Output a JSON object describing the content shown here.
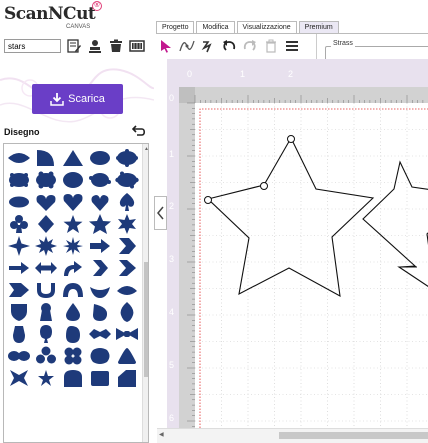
{
  "app": {
    "logo_text": "ScanNCut",
    "logo_subtext": "CANVAS",
    "logo_mark": "®"
  },
  "search": {
    "value": "stars"
  },
  "toolbar_left_icons": [
    "document-edit-icon",
    "user-stamp-icon",
    "trash-box-icon",
    "cutting-mat-icon"
  ],
  "download": {
    "label": "Scarica",
    "icon": "download-icon"
  },
  "panel": {
    "title": "Disegno",
    "back_icon": "undo-arrow-icon"
  },
  "tabs": [
    {
      "label": "Progetto"
    },
    {
      "label": "Modifica"
    },
    {
      "label": "Visualizzazione"
    },
    {
      "label": "Premium"
    }
  ],
  "toolbar": [
    "select-arrow-icon",
    "node-edit-icon",
    "freehand-icon",
    "undo-icon",
    "redo-icon",
    "delete-icon",
    "menu-icon"
  ],
  "strass": {
    "title": "Strass"
  },
  "ruler": {
    "top_labels": [
      "0",
      "1",
      "2"
    ],
    "left_labels": [
      "0",
      "1",
      "2",
      "3",
      "4",
      "5",
      "6"
    ]
  },
  "colors": {
    "accent": "#6a3ec7",
    "shape_fill": "#1e3a7a",
    "arrow_pink": "#c2188f",
    "guide_red": "#e03030"
  },
  "shapes": [
    "lens",
    "quarter-circle",
    "triangle",
    "ellipse",
    "scalloped-oval",
    "wavy-oval",
    "cloud-oval",
    "scalloped-oval-2",
    "flower-oval",
    "scalloped-oval-3",
    "flat-oval",
    "heart",
    "heart-2",
    "heart-3",
    "spade",
    "club",
    "diamond",
    "star-5",
    "star-5-b",
    "star-6",
    "star-4",
    "burst-8",
    "burst-star",
    "arrow-right",
    "chevron-right",
    "arrow-right-thin",
    "double-arrow",
    "curved-arrow",
    "chevron-2",
    "chevron-3",
    "arrow-notched",
    "cup",
    "arch",
    "crescent-smile",
    "leaf-drop",
    "shield",
    "keyhole",
    "drop",
    "drop-tilt",
    "leaf",
    "drop-down",
    "balloon",
    "egg-tilt",
    "lips",
    "bow-tie",
    "ovals-pair",
    "trefoil",
    "quatrefoil",
    "blob",
    "triangle-round",
    "cross-x",
    "star-small",
    "arch-rect",
    "round-rect",
    "corner-cut"
  ]
}
